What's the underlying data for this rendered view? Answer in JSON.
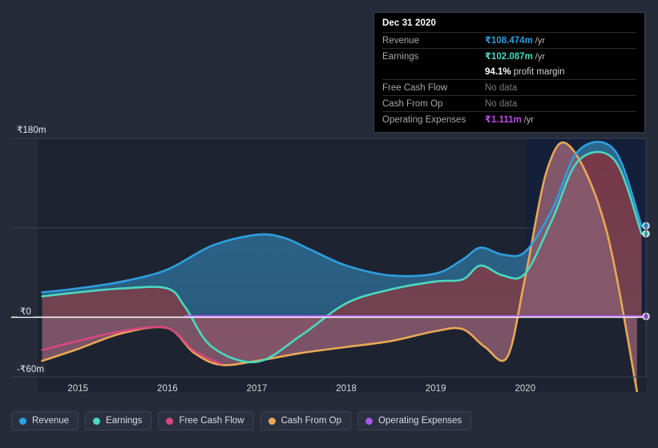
{
  "chart_data": {
    "type": "area",
    "title": "",
    "xlabel": "",
    "ylabel": "",
    "currency_symbol": "₹",
    "grid": true,
    "legend_position": "bottom",
    "xlim": [
      2014.55,
      2021.35
    ],
    "ylim": [
      -60,
      180
    ],
    "yticks": [
      {
        "value": 180,
        "label": "₹180m"
      },
      {
        "value": 0,
        "label": "₹0"
      },
      {
        "value": -60,
        "label": "-₹60m"
      }
    ],
    "gridlines": [
      180,
      90,
      0,
      -60
    ],
    "xticks": [
      "2015",
      "2016",
      "2017",
      "2018",
      "2019",
      "2020"
    ],
    "xtick_values": [
      2015,
      2016,
      2017,
      2018,
      2019,
      2020
    ],
    "forecast_start": 2020.0,
    "series": [
      {
        "name": "Revenue",
        "color": "#2e9fe0",
        "fill": "#2b5f7e",
        "x": [
          2014.6,
          2015.0,
          2015.5,
          2016.0,
          2016.5,
          2017.0,
          2017.3,
          2017.6,
          2018.0,
          2018.5,
          2019.0,
          2019.3,
          2019.5,
          2019.75,
          2020.0,
          2020.3,
          2020.6,
          2021.0,
          2021.3
        ],
        "values": [
          25,
          29,
          36,
          48,
          72,
          83,
          80,
          68,
          52,
          42,
          44,
          58,
          70,
          63,
          66,
          108,
          168,
          168,
          92
        ]
      },
      {
        "name": "Earnings",
        "color": "#4ad9c0",
        "fill": "#2f7a74",
        "x": [
          2014.6,
          2015.0,
          2015.5,
          2016.0,
          2016.2,
          2016.5,
          2017.0,
          2017.5,
          2018.0,
          2018.5,
          2019.0,
          2019.3,
          2019.5,
          2019.75,
          2020.0,
          2020.3,
          2020.6,
          2021.0,
          2021.3
        ],
        "values": [
          21,
          25,
          29,
          29,
          10,
          -30,
          -45,
          -18,
          14,
          28,
          36,
          38,
          52,
          42,
          44,
          98,
          158,
          158,
          84
        ]
      },
      {
        "name": "Free Cash Flow",
        "color": "#d9467f",
        "fill": "#6b2e40",
        "x": [
          2014.6,
          2015.0,
          2015.5,
          2016.0,
          2016.3,
          2016.6
        ],
        "values": [
          -33,
          -24,
          -14,
          -11,
          -34,
          -47
        ]
      },
      {
        "name": "Cash From Op",
        "color": "#e8a855",
        "fill": "#6b2e40",
        "x": [
          2014.6,
          2015.0,
          2015.5,
          2016.0,
          2016.3,
          2016.6,
          2017.0,
          2017.5,
          2018.0,
          2018.5,
          2019.0,
          2019.3,
          2019.55,
          2019.8,
          2020.0,
          2020.25,
          2020.5,
          2020.9,
          2021.25
        ],
        "values": [
          -44,
          -32,
          -16,
          -11,
          -36,
          -48,
          -44,
          -36,
          -30,
          -24,
          -14,
          -12,
          -30,
          -40,
          40,
          150,
          172,
          90,
          -75
        ]
      },
      {
        "name": "Operating Expenses",
        "color": "#a855e8",
        "fill": "none",
        "x": [
          2016.2,
          2021.3
        ],
        "values": [
          0.8,
          0.8
        ]
      }
    ]
  },
  "tooltip": {
    "title": "Dec 31 2020",
    "rows": [
      {
        "label": "Revenue",
        "value": "₹108.474m",
        "unit": "/yr",
        "color": "#2e9fe0",
        "no_data": false
      },
      {
        "label": "Earnings",
        "value": "₹102.087m",
        "unit": "/yr",
        "color": "#4ad9c0",
        "no_data": false
      },
      {
        "label": "",
        "value": "94.1%",
        "unit": "profit margin",
        "color": "#ffffff",
        "no_data": false,
        "is_margin": true
      },
      {
        "label": "Free Cash Flow",
        "value": "No data",
        "unit": "",
        "color": "#7a7a7a",
        "no_data": true
      },
      {
        "label": "Cash From Op",
        "value": "No data",
        "unit": "",
        "color": "#7a7a7a",
        "no_data": true
      },
      {
        "label": "Operating Expenses",
        "value": "₹1.111m",
        "unit": "/yr",
        "color": "#c14ae8",
        "no_data": false
      }
    ]
  },
  "legend": {
    "items": [
      {
        "label": "Revenue",
        "color": "#2e9fe0"
      },
      {
        "label": "Earnings",
        "color": "#4ad9c0"
      },
      {
        "label": "Free Cash Flow",
        "color": "#d9467f"
      },
      {
        "label": "Cash From Op",
        "color": "#e8a855"
      },
      {
        "label": "Operating Expenses",
        "color": "#a855e8"
      }
    ]
  },
  "colors": {
    "background": "#252b39",
    "plot_background": "#1d2331",
    "forecast_background": "#14203a",
    "gridline": "#3a4052",
    "zero_line": "#ffffff",
    "tooltip_background": "#000000"
  }
}
